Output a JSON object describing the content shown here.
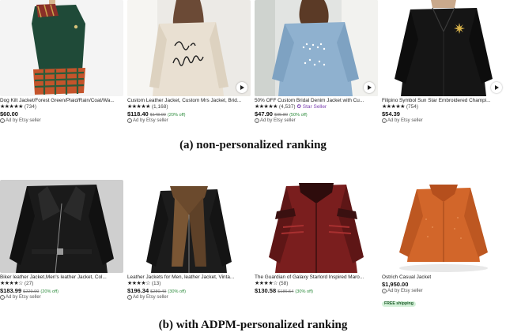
{
  "colors": {
    "discount": "#2a8a3a",
    "star_seller": "#7a3fb0",
    "free_shipping_bg": "#d4f1d9"
  },
  "rows": [
    {
      "caption": "(a) non-personalized ranking",
      "items": [
        {
          "image": "dog-jacket-green-plaid",
          "title": "Dog Kilt Jacket/Forest Green/Plaid/Rain/Coat/Wa...",
          "stars": "★★★★★",
          "rating_count": "(734)",
          "star_seller": "",
          "price": "$60.00",
          "original_price": "",
          "discount": "",
          "ad_label": "Ad by Etsy seller",
          "free_shipping": ""
        },
        {
          "image": "cream-leather-jacket-mrs-script",
          "title": "Custom Leather Jacket, Custom Mrs Jacket, Brid...",
          "stars": "★★★★★",
          "rating_count": "(1,168)",
          "star_seller": "",
          "price": "$118.40",
          "original_price": "$148.00",
          "discount": "(20% off)",
          "ad_label": "Ad by Etsy seller",
          "free_shipping": ""
        },
        {
          "image": "denim-jacket-mrs-pearls",
          "title": "50% OFF Custom Bridal Denim Jacket with Cu...",
          "stars": "★★★★★",
          "rating_count": "(4,537)",
          "star_seller": "✪ Star Seller",
          "price": "$47.90",
          "original_price": "$95.80",
          "discount": "(50% off)",
          "ad_label": "Ad by Etsy seller",
          "free_shipping": ""
        },
        {
          "image": "black-windbreaker-gold-emblem",
          "title": "Filipino Symbol Sun Star Embroidered Champi...",
          "stars": "★★★★★",
          "rating_count": "(754)",
          "star_seller": "",
          "price": "$54.39",
          "original_price": "",
          "discount": "",
          "ad_label": "Ad by Etsy seller",
          "free_shipping": ""
        }
      ]
    },
    {
      "caption": "(b) with ADPM-personalized ranking",
      "items": [
        {
          "image": "black-leather-biker-jacket",
          "title": "Biker leather Jacket,Men's leather Jacket, Col...",
          "stars": "★★★★☆",
          "rating_count": "(27)",
          "star_seller": "",
          "price": "$183.99",
          "original_price": "$229.99",
          "discount": "(20% off)",
          "ad_label": "Ad by Etsy seller",
          "free_shipping": ""
        },
        {
          "image": "black-leather-shearling-collar",
          "title": "Leather Jackets for Men, leather Jacket, Vinta...",
          "stars": "★★★★☆",
          "rating_count": "(13)",
          "star_seller": "",
          "price": "$196.34",
          "original_price": "$280.49",
          "discount": "(30% off)",
          "ad_label": "Ad by Etsy seller",
          "free_shipping": ""
        },
        {
          "image": "red-star-lord-jacket",
          "title": "The Guardian of Galaxy Starlord Inspired Maro...",
          "stars": "★★★★☆",
          "rating_count": "(58)",
          "star_seller": "",
          "price": "$130.58",
          "original_price": "$186.54",
          "discount": "(30% off)",
          "ad_label": "",
          "free_shipping": ""
        },
        {
          "image": "orange-ostrich-jacket",
          "title": "Ostrich Casual Jacket",
          "stars": "",
          "rating_count": "",
          "star_seller": "",
          "price": "$1,950.00",
          "original_price": "",
          "discount": "",
          "ad_label": "Ad by Etsy seller",
          "free_shipping": "FREE shipping"
        }
      ]
    }
  ]
}
